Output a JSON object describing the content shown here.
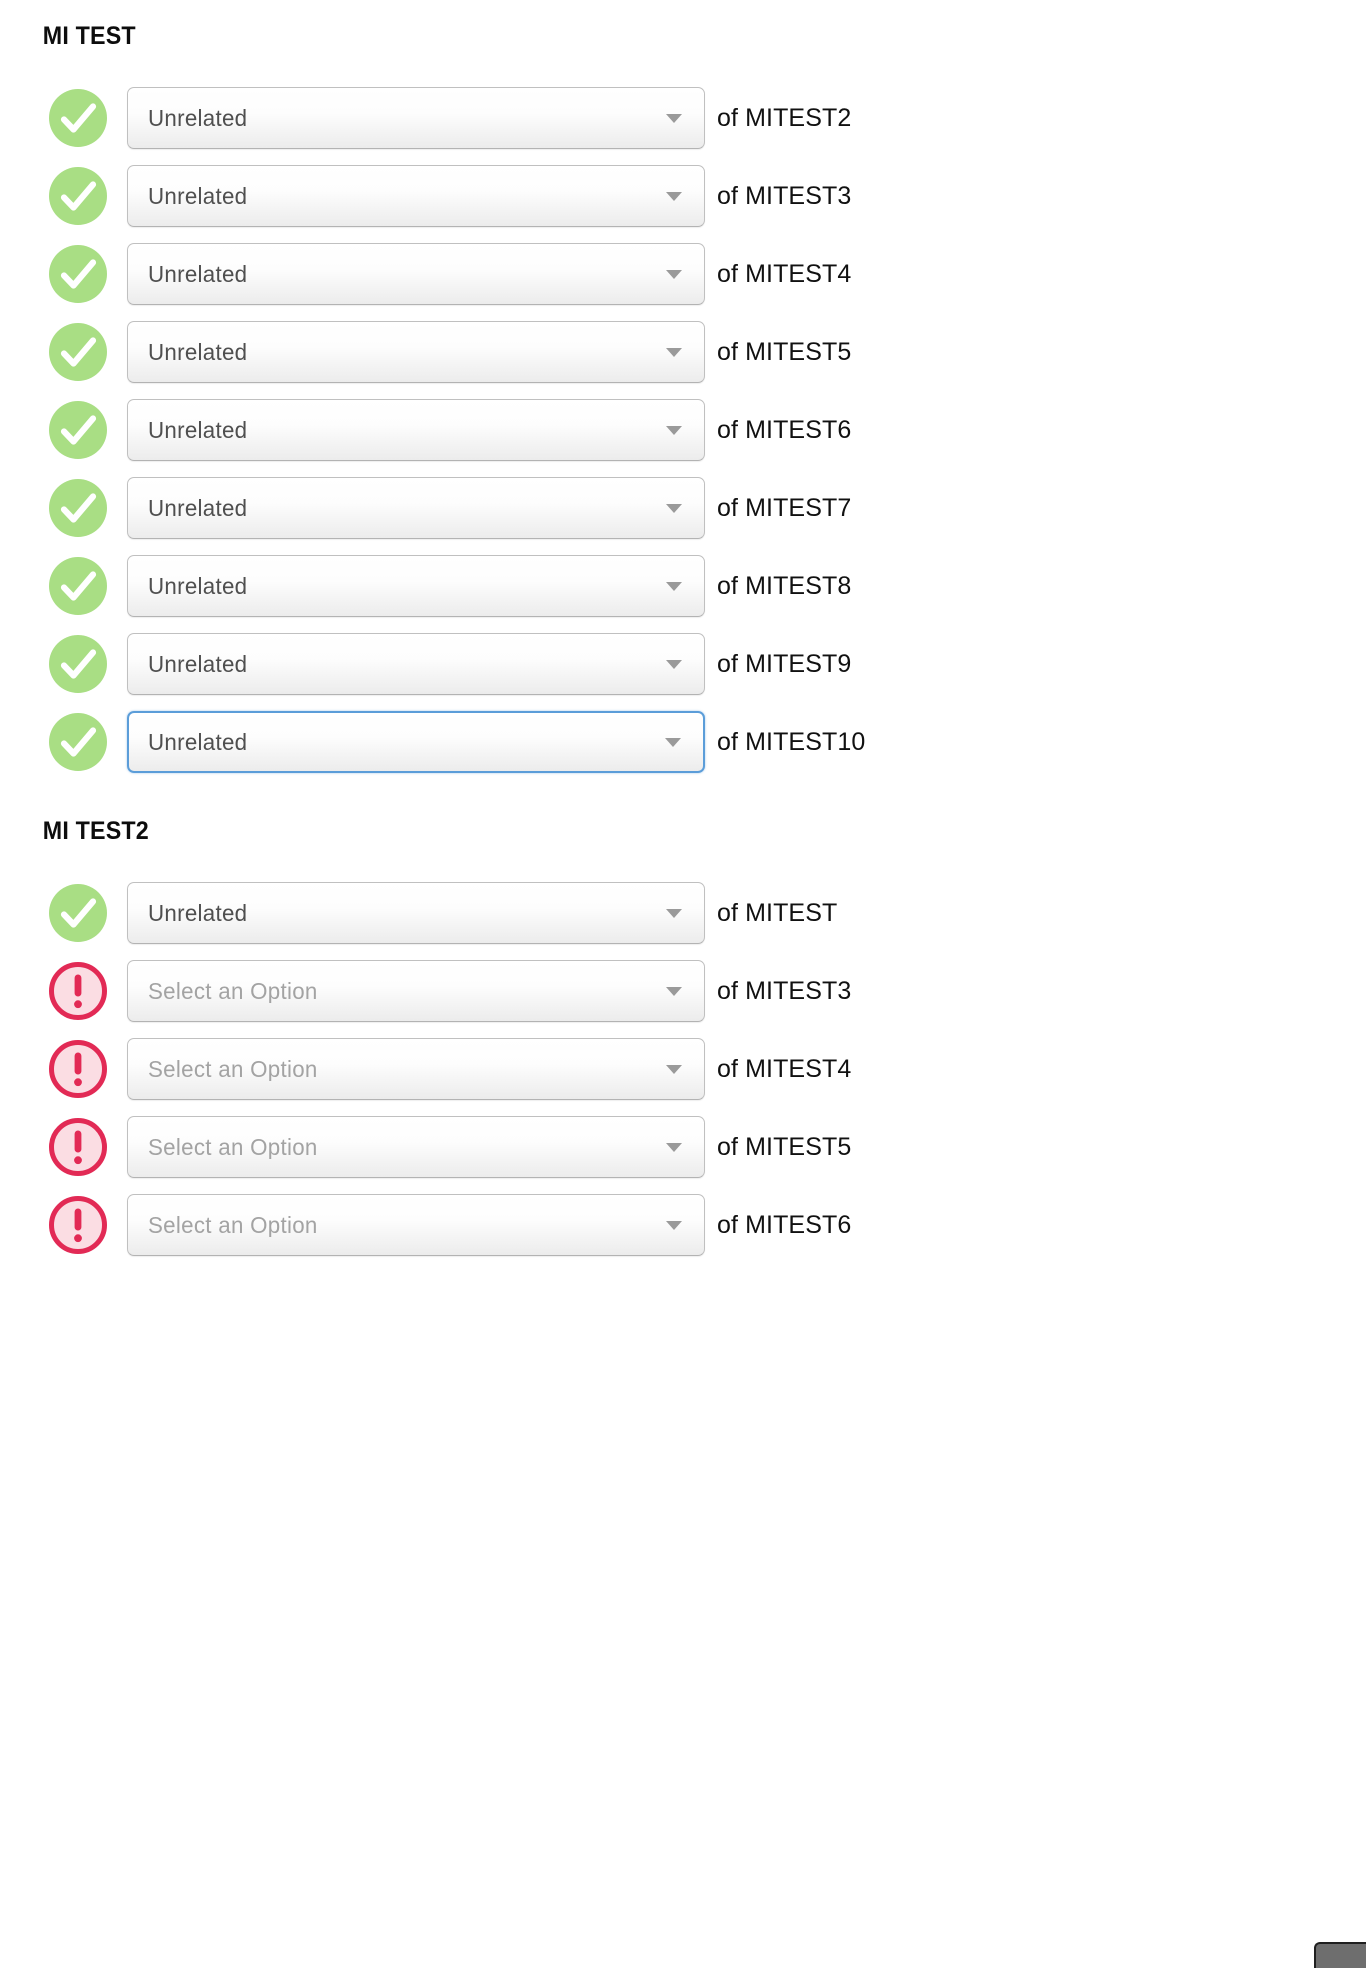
{
  "page": {
    "background_color": "#ffffff",
    "select_placeholder": "Select an Option"
  },
  "icons": {
    "valid": {
      "name": "valid-check-icon",
      "fill": "#a9de84",
      "glyph": "check"
    },
    "error": {
      "name": "error-exclamation-icon",
      "fill": "#fbdde3",
      "ring": "#e22a55",
      "glyph": "exclamation"
    }
  },
  "colors": {
    "focus_border": "#5b9dd9",
    "select_border": "#c0c0c0",
    "value_text": "#4f4f4f",
    "placeholder_text": "#a3a3a3",
    "label_text": "#111111",
    "heading_text": "#0d0d0d",
    "arrow": "#9a9a9a"
  },
  "sections": [
    {
      "id": "mi-test",
      "heading": "MI TEST",
      "rows": [
        {
          "status": "valid",
          "value": "Unrelated",
          "is_placeholder": false,
          "label": "of MITEST2",
          "focused": false
        },
        {
          "status": "valid",
          "value": "Unrelated",
          "is_placeholder": false,
          "label": "of MITEST3",
          "focused": false
        },
        {
          "status": "valid",
          "value": "Unrelated",
          "is_placeholder": false,
          "label": "of MITEST4",
          "focused": false
        },
        {
          "status": "valid",
          "value": "Unrelated",
          "is_placeholder": false,
          "label": "of MITEST5",
          "focused": false
        },
        {
          "status": "valid",
          "value": "Unrelated",
          "is_placeholder": false,
          "label": "of MITEST6",
          "focused": false
        },
        {
          "status": "valid",
          "value": "Unrelated",
          "is_placeholder": false,
          "label": "of MITEST7",
          "focused": false
        },
        {
          "status": "valid",
          "value": "Unrelated",
          "is_placeholder": false,
          "label": "of MITEST8",
          "focused": false
        },
        {
          "status": "valid",
          "value": "Unrelated",
          "is_placeholder": false,
          "label": "of MITEST9",
          "focused": false
        },
        {
          "status": "valid",
          "value": "Unrelated",
          "is_placeholder": false,
          "label": "of MITEST10",
          "focused": true
        }
      ]
    },
    {
      "id": "mi-test2",
      "heading": "MI TEST2",
      "rows": [
        {
          "status": "valid",
          "value": "Unrelated",
          "is_placeholder": false,
          "label": "of MITEST",
          "focused": false
        },
        {
          "status": "error",
          "value": "Select an Option",
          "is_placeholder": true,
          "label": "of MITEST3",
          "focused": false
        },
        {
          "status": "error",
          "value": "Select an Option",
          "is_placeholder": true,
          "label": "of MITEST4",
          "focused": false
        },
        {
          "status": "error",
          "value": "Select an Option",
          "is_placeholder": true,
          "label": "of MITEST5",
          "focused": false
        },
        {
          "status": "error",
          "value": "Select an Option",
          "is_placeholder": true,
          "label": "of MITEST6",
          "focused": false
        }
      ]
    }
  ],
  "corner_handle": {
    "name": "resize-handle"
  }
}
